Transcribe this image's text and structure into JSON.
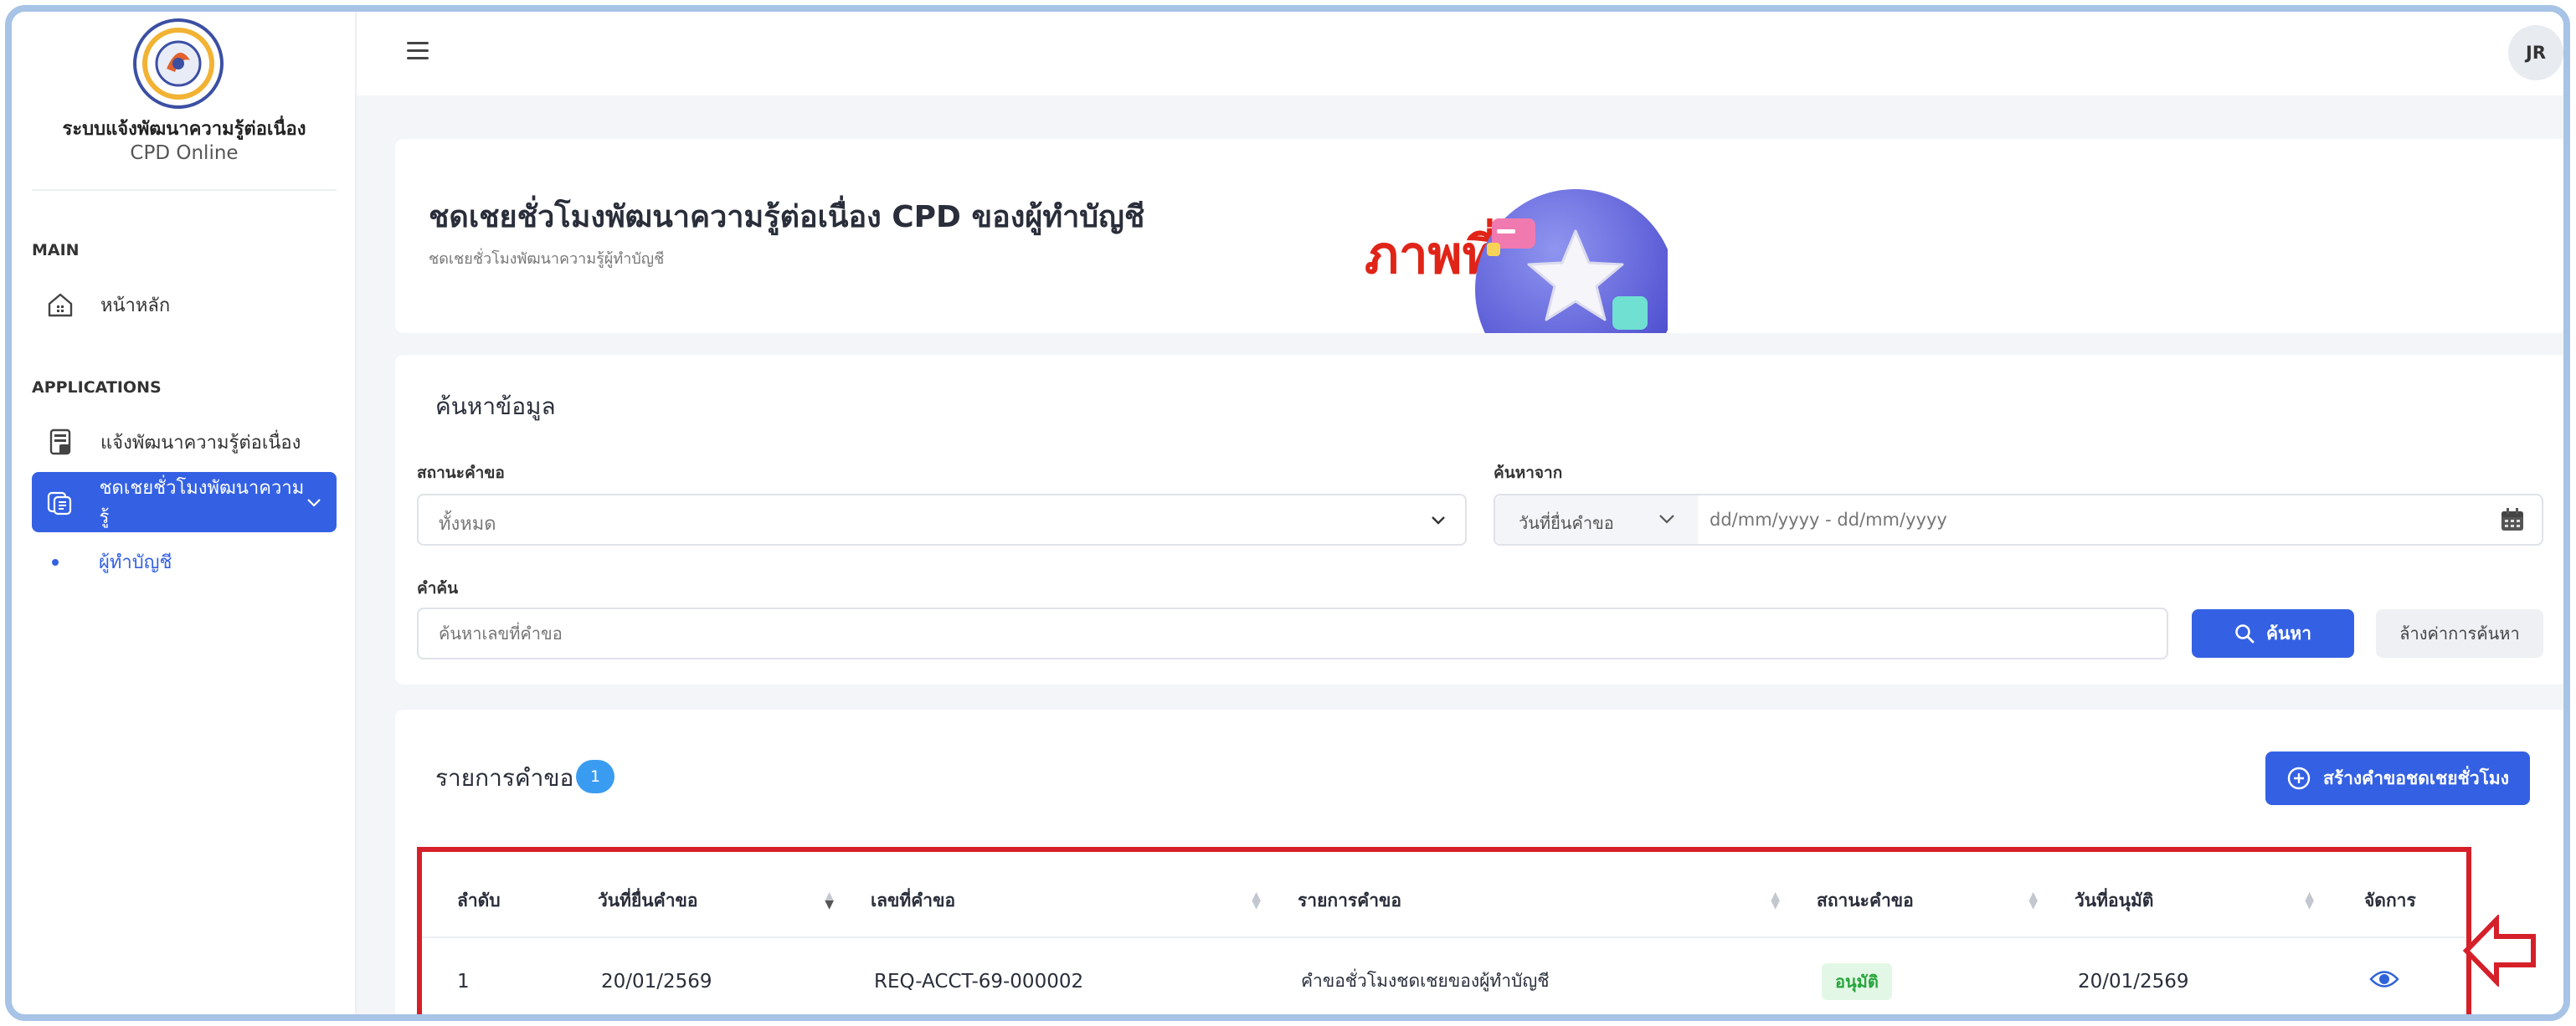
{
  "sidebar": {
    "org_title": "ระบบแจ้งพัฒนาความรู้ต่อเนื่อง",
    "org_subtitle": "CPD Online",
    "section_main": "MAIN",
    "section_applications": "APPLICATIONS",
    "items": [
      {
        "label": "หน้าหลัก",
        "icon": "home-icon"
      },
      {
        "label": "แจ้งพัฒนาความรู้ต่อเนื่อง",
        "icon": "document-icon"
      },
      {
        "label": "ชดเชยชั่วโมงพัฒนาความรู้",
        "icon": "files-icon",
        "active": true
      }
    ],
    "sub_items": [
      {
        "label": "ผู้ทำบัญชี"
      }
    ]
  },
  "topbar": {
    "avatar_initials": "JR"
  },
  "hero": {
    "title": "ชดเชยชั่วโมงพัฒนาความรู้ต่อเนื่อง CPD ของผู้ทำบัญชี",
    "subtitle": "ชดเชยชั่วโมงพัฒนาความรู้ผู้ทำบัญชี",
    "annotation": "ภาพที่ 1"
  },
  "search": {
    "title": "ค้นหาข้อมูล",
    "status_label": "สถานะคำขอ",
    "status_value": "ทั้งหมด",
    "search_from_label": "ค้นหาจาก",
    "search_from_value": "วันที่ยื่นคำขอ",
    "date_placeholder": "dd/mm/yyyy - dd/mm/yyyy",
    "keyword_label": "คำค้น",
    "keyword_placeholder": "ค้นหาเลขที่คำขอ",
    "search_button": "ค้นหา",
    "clear_button": "ล้างค่าการค้นหา"
  },
  "list": {
    "title": "รายการคำขอ",
    "count": "1",
    "create_button": "สร้างคำขอชดเชยชั่วโมง",
    "columns": [
      "ลำดับ",
      "วันที่ยื่นคำขอ",
      "เลขที่คำขอ",
      "รายการคำขอ",
      "สถานะคำขอ",
      "วันที่อนุมัติ",
      "จัดการ"
    ],
    "rows": [
      {
        "no": "1",
        "submit_date": "20/01/2569",
        "request_no": "REQ-ACCT-69-000002",
        "request_item": "คำขอชั่วโมงชดเชยของผู้ทำบัญชี",
        "status": "อนุมัติ",
        "approve_date": "20/01/2569",
        "action_icon": "eye-icon"
      }
    ]
  },
  "colors": {
    "primary": "#3461e3",
    "annotation_red": "#d5202a",
    "approved_green": "#27a53c"
  }
}
